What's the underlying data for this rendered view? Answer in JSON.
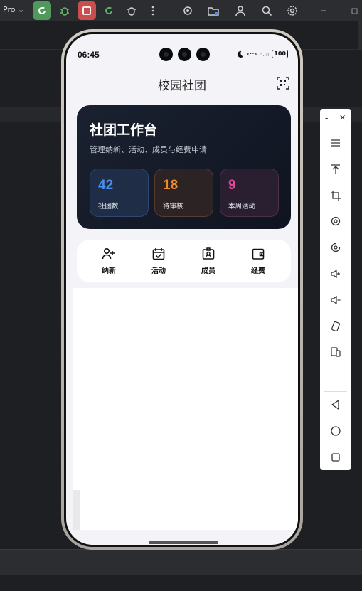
{
  "ide": {
    "project_label": "Pro ⌄",
    "colors": {
      "toolbar_bg": "#2b2d30",
      "editor_bg": "#1e1f22",
      "run_green": "#4f9a5a",
      "stop_red": "#c94f4f"
    }
  },
  "phone": {
    "status_bar": {
      "time": "06:45",
      "icons": [
        "moon-icon",
        "nfc-icon",
        "signal-icon",
        "battery-icon"
      ],
      "network": "‹··›",
      "signal": "ˣ.ııı",
      "battery": "100"
    },
    "header": {
      "title": "校园社团",
      "scan_icon": "scan-icon"
    },
    "hero": {
      "title": "社团工作台",
      "subtitle": "管理纳新、活动、成员与经费申请",
      "stats": [
        {
          "value": "42",
          "label": "社团数",
          "color": "#4a90f0"
        },
        {
          "value": "18",
          "label": "待审核",
          "color": "#f0892a"
        },
        {
          "value": "9",
          "label": "本周活动",
          "color": "#e8489a"
        }
      ]
    },
    "quick_actions": [
      {
        "label": "纳新",
        "icon": "add-user-icon"
      },
      {
        "label": "活动",
        "icon": "calendar-check-icon"
      },
      {
        "label": "成员",
        "icon": "member-card-icon"
      },
      {
        "label": "经费",
        "icon": "wallet-icon"
      }
    ]
  },
  "emulator_panel": {
    "window_controls": {
      "minimize": "-",
      "close": "✕"
    }
  }
}
